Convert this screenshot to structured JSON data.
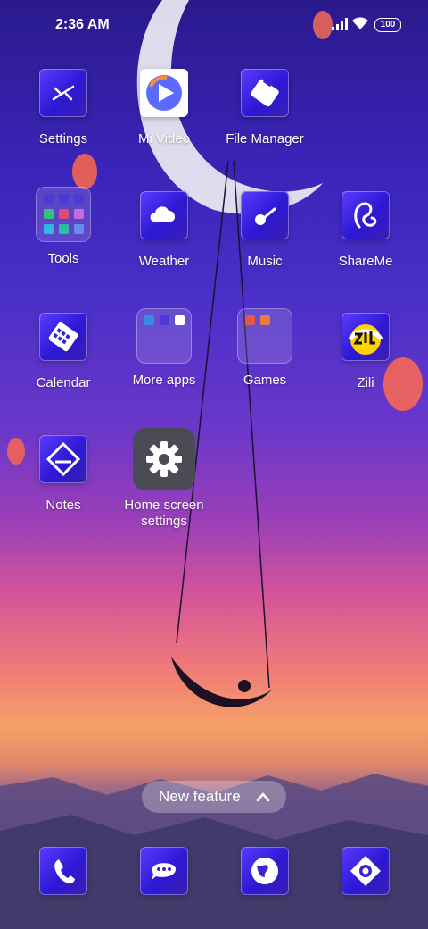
{
  "status_bar": {
    "time": "2:36 AM",
    "battery": "100"
  },
  "apps": {
    "settings": "Settings",
    "mi_video": "Mi Video",
    "file_manager": "File Manager",
    "tools": "Tools",
    "weather": "Weather",
    "music": "Music",
    "shareme": "ShareMe",
    "calendar": "Calendar",
    "more_apps": "More apps",
    "games": "Games",
    "zili": "Zili",
    "notes": "Notes",
    "home_screen_settings": "Home screen settings"
  },
  "new_feature": {
    "label": "New feature"
  },
  "dock": {
    "icons": [
      "phone-icon",
      "messages-icon",
      "browser-icon",
      "camera-icon"
    ]
  },
  "colors": {
    "icon_blue": "#3a22d8",
    "wallpaper_top": "#2a1a8c",
    "wallpaper_sunset": "#f07a78"
  }
}
